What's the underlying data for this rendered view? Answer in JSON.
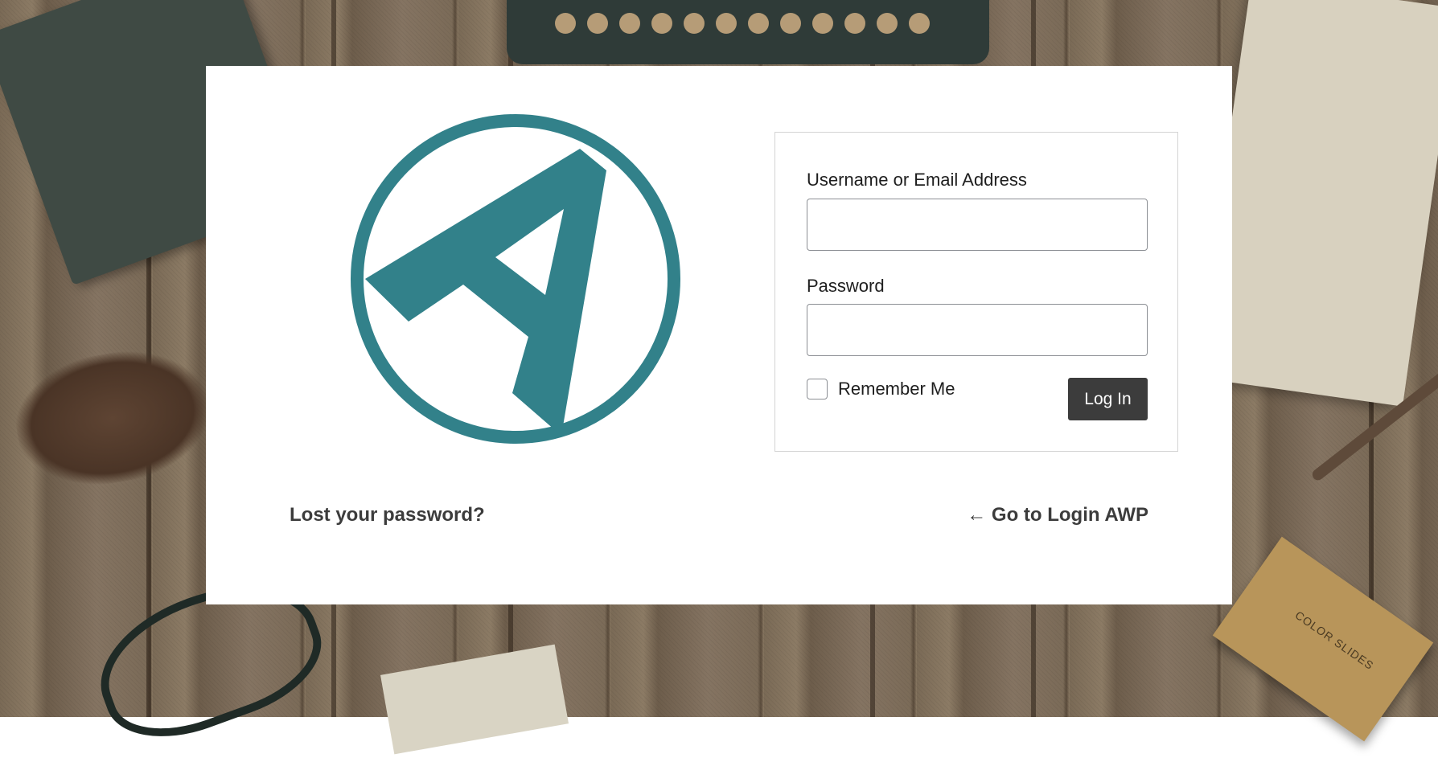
{
  "login_form": {
    "username_label": "Username or Email Address",
    "username_value": "",
    "password_label": "Password",
    "password_value": "",
    "show_password_icon": "eye-icon",
    "remember_label": "Remember Me",
    "remember_checked": false,
    "login_button": "Log In"
  },
  "links": {
    "lost_password": "Lost your password?",
    "go_to_site": "← Go to Login AWP"
  },
  "background": {
    "slides_box_text": "COLOR SLIDES"
  },
  "colors": {
    "logo_teal": "#32818a",
    "button_bg": "#3c3c3c",
    "eye_icon": "#2271b1"
  }
}
